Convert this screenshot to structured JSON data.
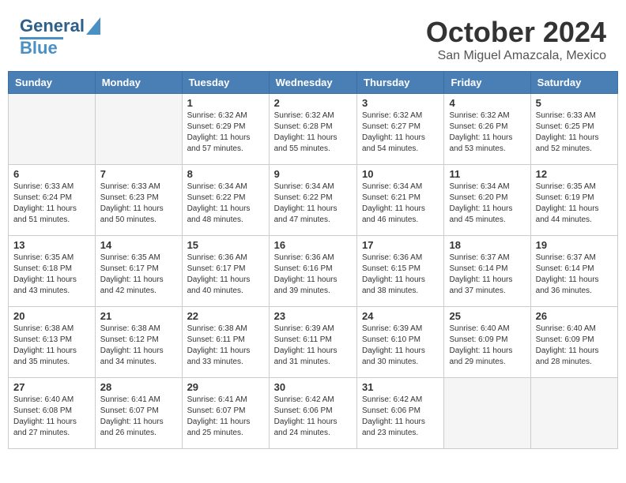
{
  "header": {
    "logo_general": "General",
    "logo_blue": "Blue",
    "month_title": "October 2024",
    "location": "San Miguel Amazcala, Mexico"
  },
  "weekdays": [
    "Sunday",
    "Monday",
    "Tuesday",
    "Wednesday",
    "Thursday",
    "Friday",
    "Saturday"
  ],
  "weeks": [
    [
      {
        "day": "",
        "empty": true
      },
      {
        "day": "",
        "empty": true
      },
      {
        "day": "1",
        "sunrise": "Sunrise: 6:32 AM",
        "sunset": "Sunset: 6:29 PM",
        "daylight": "Daylight: 11 hours and 57 minutes."
      },
      {
        "day": "2",
        "sunrise": "Sunrise: 6:32 AM",
        "sunset": "Sunset: 6:28 PM",
        "daylight": "Daylight: 11 hours and 55 minutes."
      },
      {
        "day": "3",
        "sunrise": "Sunrise: 6:32 AM",
        "sunset": "Sunset: 6:27 PM",
        "daylight": "Daylight: 11 hours and 54 minutes."
      },
      {
        "day": "4",
        "sunrise": "Sunrise: 6:32 AM",
        "sunset": "Sunset: 6:26 PM",
        "daylight": "Daylight: 11 hours and 53 minutes."
      },
      {
        "day": "5",
        "sunrise": "Sunrise: 6:33 AM",
        "sunset": "Sunset: 6:25 PM",
        "daylight": "Daylight: 11 hours and 52 minutes."
      }
    ],
    [
      {
        "day": "6",
        "sunrise": "Sunrise: 6:33 AM",
        "sunset": "Sunset: 6:24 PM",
        "daylight": "Daylight: 11 hours and 51 minutes."
      },
      {
        "day": "7",
        "sunrise": "Sunrise: 6:33 AM",
        "sunset": "Sunset: 6:23 PM",
        "daylight": "Daylight: 11 hours and 50 minutes."
      },
      {
        "day": "8",
        "sunrise": "Sunrise: 6:34 AM",
        "sunset": "Sunset: 6:22 PM",
        "daylight": "Daylight: 11 hours and 48 minutes."
      },
      {
        "day": "9",
        "sunrise": "Sunrise: 6:34 AM",
        "sunset": "Sunset: 6:22 PM",
        "daylight": "Daylight: 11 hours and 47 minutes."
      },
      {
        "day": "10",
        "sunrise": "Sunrise: 6:34 AM",
        "sunset": "Sunset: 6:21 PM",
        "daylight": "Daylight: 11 hours and 46 minutes."
      },
      {
        "day": "11",
        "sunrise": "Sunrise: 6:34 AM",
        "sunset": "Sunset: 6:20 PM",
        "daylight": "Daylight: 11 hours and 45 minutes."
      },
      {
        "day": "12",
        "sunrise": "Sunrise: 6:35 AM",
        "sunset": "Sunset: 6:19 PM",
        "daylight": "Daylight: 11 hours and 44 minutes."
      }
    ],
    [
      {
        "day": "13",
        "sunrise": "Sunrise: 6:35 AM",
        "sunset": "Sunset: 6:18 PM",
        "daylight": "Daylight: 11 hours and 43 minutes."
      },
      {
        "day": "14",
        "sunrise": "Sunrise: 6:35 AM",
        "sunset": "Sunset: 6:17 PM",
        "daylight": "Daylight: 11 hours and 42 minutes."
      },
      {
        "day": "15",
        "sunrise": "Sunrise: 6:36 AM",
        "sunset": "Sunset: 6:17 PM",
        "daylight": "Daylight: 11 hours and 40 minutes."
      },
      {
        "day": "16",
        "sunrise": "Sunrise: 6:36 AM",
        "sunset": "Sunset: 6:16 PM",
        "daylight": "Daylight: 11 hours and 39 minutes."
      },
      {
        "day": "17",
        "sunrise": "Sunrise: 6:36 AM",
        "sunset": "Sunset: 6:15 PM",
        "daylight": "Daylight: 11 hours and 38 minutes."
      },
      {
        "day": "18",
        "sunrise": "Sunrise: 6:37 AM",
        "sunset": "Sunset: 6:14 PM",
        "daylight": "Daylight: 11 hours and 37 minutes."
      },
      {
        "day": "19",
        "sunrise": "Sunrise: 6:37 AM",
        "sunset": "Sunset: 6:14 PM",
        "daylight": "Daylight: 11 hours and 36 minutes."
      }
    ],
    [
      {
        "day": "20",
        "sunrise": "Sunrise: 6:38 AM",
        "sunset": "Sunset: 6:13 PM",
        "daylight": "Daylight: 11 hours and 35 minutes."
      },
      {
        "day": "21",
        "sunrise": "Sunrise: 6:38 AM",
        "sunset": "Sunset: 6:12 PM",
        "daylight": "Daylight: 11 hours and 34 minutes."
      },
      {
        "day": "22",
        "sunrise": "Sunrise: 6:38 AM",
        "sunset": "Sunset: 6:11 PM",
        "daylight": "Daylight: 11 hours and 33 minutes."
      },
      {
        "day": "23",
        "sunrise": "Sunrise: 6:39 AM",
        "sunset": "Sunset: 6:11 PM",
        "daylight": "Daylight: 11 hours and 31 minutes."
      },
      {
        "day": "24",
        "sunrise": "Sunrise: 6:39 AM",
        "sunset": "Sunset: 6:10 PM",
        "daylight": "Daylight: 11 hours and 30 minutes."
      },
      {
        "day": "25",
        "sunrise": "Sunrise: 6:40 AM",
        "sunset": "Sunset: 6:09 PM",
        "daylight": "Daylight: 11 hours and 29 minutes."
      },
      {
        "day": "26",
        "sunrise": "Sunrise: 6:40 AM",
        "sunset": "Sunset: 6:09 PM",
        "daylight": "Daylight: 11 hours and 28 minutes."
      }
    ],
    [
      {
        "day": "27",
        "sunrise": "Sunrise: 6:40 AM",
        "sunset": "Sunset: 6:08 PM",
        "daylight": "Daylight: 11 hours and 27 minutes."
      },
      {
        "day": "28",
        "sunrise": "Sunrise: 6:41 AM",
        "sunset": "Sunset: 6:07 PM",
        "daylight": "Daylight: 11 hours and 26 minutes."
      },
      {
        "day": "29",
        "sunrise": "Sunrise: 6:41 AM",
        "sunset": "Sunset: 6:07 PM",
        "daylight": "Daylight: 11 hours and 25 minutes."
      },
      {
        "day": "30",
        "sunrise": "Sunrise: 6:42 AM",
        "sunset": "Sunset: 6:06 PM",
        "daylight": "Daylight: 11 hours and 24 minutes."
      },
      {
        "day": "31",
        "sunrise": "Sunrise: 6:42 AM",
        "sunset": "Sunset: 6:06 PM",
        "daylight": "Daylight: 11 hours and 23 minutes."
      },
      {
        "day": "",
        "empty": true
      },
      {
        "day": "",
        "empty": true
      }
    ]
  ]
}
